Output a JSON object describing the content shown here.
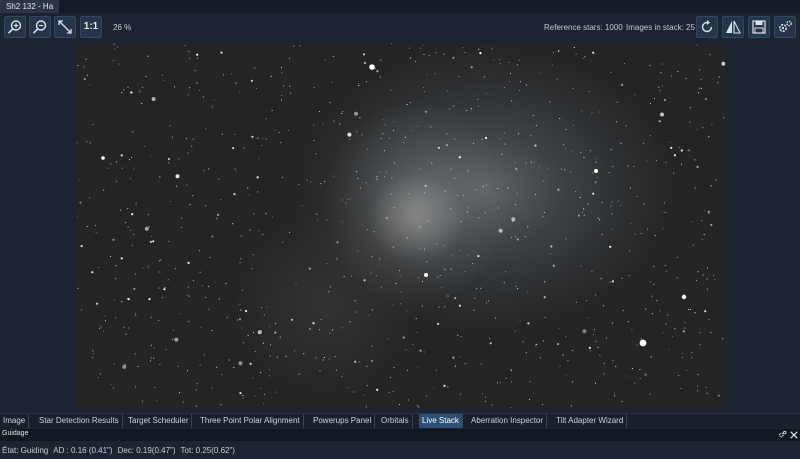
{
  "window": {
    "tab_title": "Sh2 132 - Ha"
  },
  "toolbar": {
    "zoom_in_icon": "zoom-in-icon",
    "zoom_out_icon": "zoom-out-icon",
    "fit_icon": "fit-diagonal-icon",
    "ratio_label": "1:1",
    "zoom_level": "26 %",
    "reference_stars": "Reference stars: 1000",
    "images_in_stack": "Images in stack: 25",
    "right_icons": [
      "refresh-icon",
      "flip-icon",
      "save-icon",
      "settings-icon"
    ]
  },
  "bottom_tabs": [
    {
      "label": "Image",
      "active": false
    },
    {
      "label": "Star Detection Results",
      "active": false
    },
    {
      "label": "Target Scheduler",
      "active": false
    },
    {
      "label": "Three Point Polar Alignment",
      "active": false
    },
    {
      "label": "Powerups Panel",
      "active": false
    },
    {
      "label": "Orbitals",
      "active": false
    },
    {
      "label": "Live Stack",
      "active": true
    },
    {
      "label": "Aberration Inspector",
      "active": false
    },
    {
      "label": "Tilt Adapter Wizard",
      "active": false
    }
  ],
  "guiding": {
    "title": "Guidage",
    "status_state": "État: Guiding",
    "ad": "AD : 0.16 (0.41\")",
    "dec": "Dec: 0.19(0.47\")",
    "tot": "Tot: 0.25(0.62\")"
  },
  "colors": {
    "background": "#1c2331",
    "active_tab": "#2d4f74",
    "button": "#26354a"
  }
}
